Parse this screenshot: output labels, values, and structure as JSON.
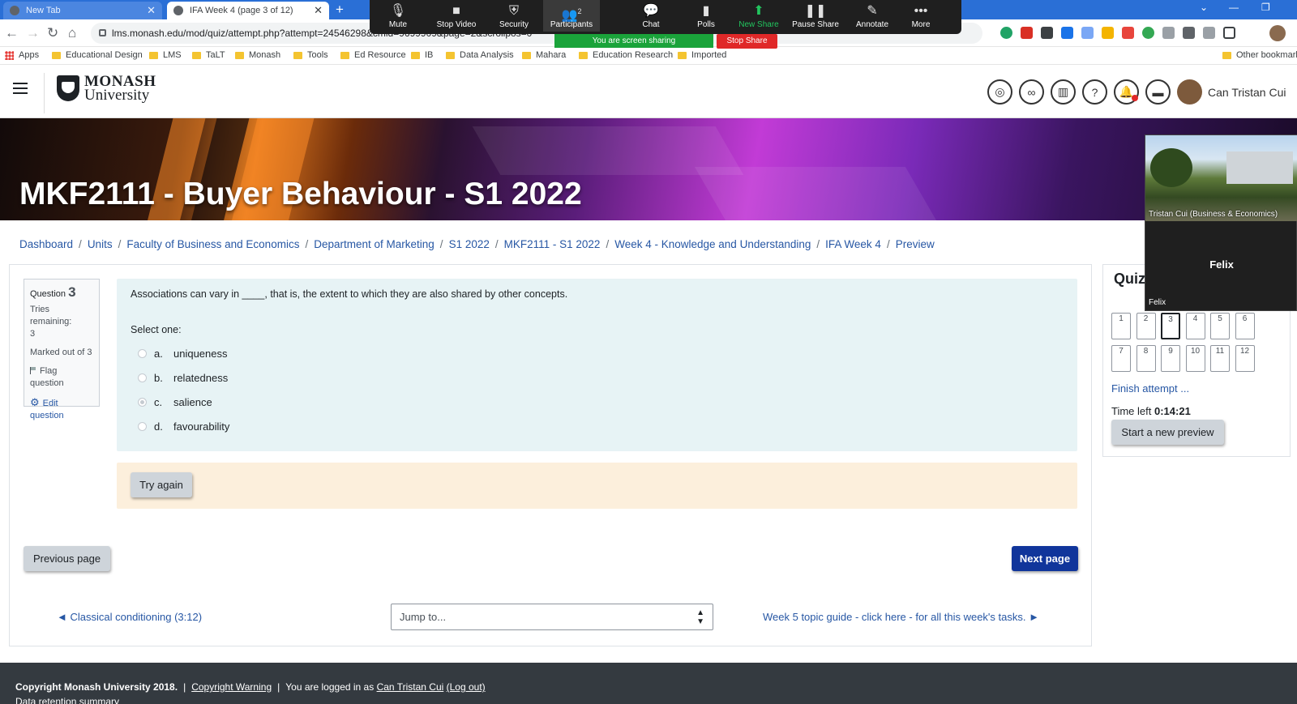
{
  "browser": {
    "tabs": [
      {
        "title": "New Tab"
      },
      {
        "title": "IFA Week 4 (page 3 of 12)"
      }
    ],
    "url": "lms.monash.edu/mod/quiz/attempt.php?attempt=24546298&cmid=9699909&page=2&scrollpos=0",
    "bookmarks": [
      "Apps",
      "Educational Design",
      "LMS",
      "TaLT",
      "Monash",
      "Tools",
      "Ed Resource",
      "IB",
      "Data Analysis",
      "Mahara",
      "Education Research",
      "Imported"
    ],
    "other_bookmarks": "Other bookmarks"
  },
  "zoom": {
    "items": [
      {
        "label": "Mute",
        "icon": "microphone-icon"
      },
      {
        "label": "Stop Video",
        "icon": "video-camera-icon"
      },
      {
        "label": "Security",
        "icon": "shield-icon"
      },
      {
        "label": "Participants",
        "icon": "participants-icon",
        "count": "2"
      },
      {
        "label": "Chat",
        "icon": "chat-icon"
      },
      {
        "label": "Polls",
        "icon": "polls-icon"
      },
      {
        "label": "New Share",
        "icon": "share-icon"
      },
      {
        "label": "Pause Share",
        "icon": "pause-icon"
      },
      {
        "label": "Annotate",
        "icon": "pen-icon"
      },
      {
        "label": "More",
        "icon": "more-icon"
      }
    ],
    "sharing_status": "You are screen sharing",
    "stop_share": "Stop Share",
    "video_panel": {
      "camera_label": "Tristan Cui (Business & Economics)",
      "participant_name": "Felix",
      "participant_label": "Felix"
    }
  },
  "site": {
    "logo_line1": "MONASH",
    "logo_line2": "University",
    "user_name": "Can Tristan Cui",
    "course_title": "MKF2111 - Buyer Behaviour - S1 2022"
  },
  "breadcrumb": [
    "Dashboard",
    "Units",
    "Faculty of Business and Economics",
    "Department of Marketing",
    "S1 2022",
    "MKF2111 - S1 2022",
    "Week 4 - Knowledge and Understanding",
    "IFA Week 4",
    "Preview"
  ],
  "question": {
    "label": "Question",
    "number": "3",
    "tries_remaining_label": "Tries remaining:",
    "tries_remaining": "3",
    "marked_out_of": "Marked out of 3",
    "flag_label": "Flag question",
    "edit_label": "Edit",
    "edit_label2": "question",
    "text": "Associations can vary in ____, that is, the extent to which they are also shared by other concepts.",
    "select_one": "Select one:",
    "answers": [
      {
        "letter": "a.",
        "text": "uniqueness",
        "selected": false
      },
      {
        "letter": "b.",
        "text": "relatedness",
        "selected": false
      },
      {
        "letter": "c.",
        "text": "salience",
        "selected": true
      },
      {
        "letter": "d.",
        "text": "favourability",
        "selected": false
      }
    ],
    "try_again": "Try again"
  },
  "navigation": {
    "previous_page": "Previous page",
    "next_page": "Next page",
    "prev_activity": "◄ Classical conditioning (3:12)",
    "jump_to": "Jump to...",
    "next_activity": "Week 5 topic guide - click here - for all this week's tasks. ►"
  },
  "quiz_nav": {
    "title": "Quiz",
    "row1": [
      "1",
      "2",
      "3",
      "4",
      "5",
      "6"
    ],
    "row2": [
      "7",
      "8",
      "9",
      "10",
      "11",
      "12"
    ],
    "current": "3",
    "finish_attempt": "Finish attempt ...",
    "time_left_label": "Time left",
    "time_left": "0:14:21",
    "start_new_preview": "Start a new preview"
  },
  "footer": {
    "copyright": "Copyright Monash University 2018.",
    "warning": "Copyright Warning",
    "logged_in_prefix": "You are logged in as",
    "user": "Can Tristan Cui",
    "logout": "(Log out)",
    "data_retention": "Data retention summary"
  },
  "colors": {
    "link": "#2757a4",
    "primary_button": "#10359b",
    "formulation_bg": "#e7f3f5",
    "outcome_bg": "#fcefdc",
    "footer_bg": "#343a40",
    "zoom_green": "#22c55e",
    "stop_share_red": "#e02828"
  }
}
